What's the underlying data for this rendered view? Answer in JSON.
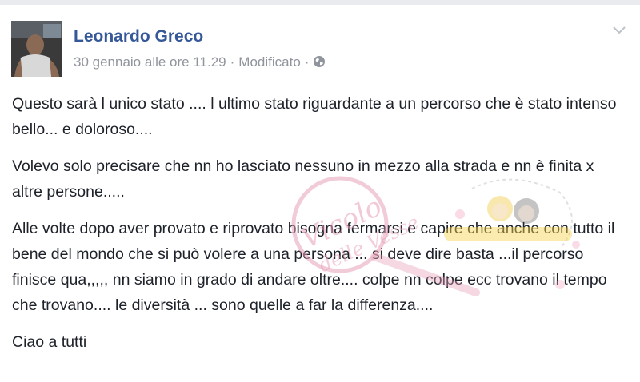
{
  "post": {
    "author": "Leonardo Greco",
    "timestamp": "30 gennaio alle ore 11.29",
    "separator": "·",
    "edited_label": "Modificato",
    "privacy_icon": "globe-icon",
    "menu_icon": "chevron-down-icon",
    "paragraphs": [
      "Questo sarà l unico stato .... l ultimo stato riguardante a un percorso che è stato intenso bello... e doloroso....",
      "Volevo solo precisare che nn ho lasciato nessuno in mezzo alla strada e nn è finita x altre persone.....",
      "Alle volte dopo aver provato e riprovato bisogna fermarsi e capire che anche con tutto il bene del mondo che si può volere a una persona ... si deve dire basta ...il percorso finisce qua,,,,, nn siamo in grado di andare oltre.... colpe nn colpe ecc trovano il tempo che trovano.... le diversità ... sono quelle a far la differenza....",
      "Ciao a tutti"
    ]
  },
  "colors": {
    "author_link": "#365899",
    "meta_text": "#90949c",
    "body_text": "#1d2129",
    "watermark_pink": "#e8a0b8"
  }
}
